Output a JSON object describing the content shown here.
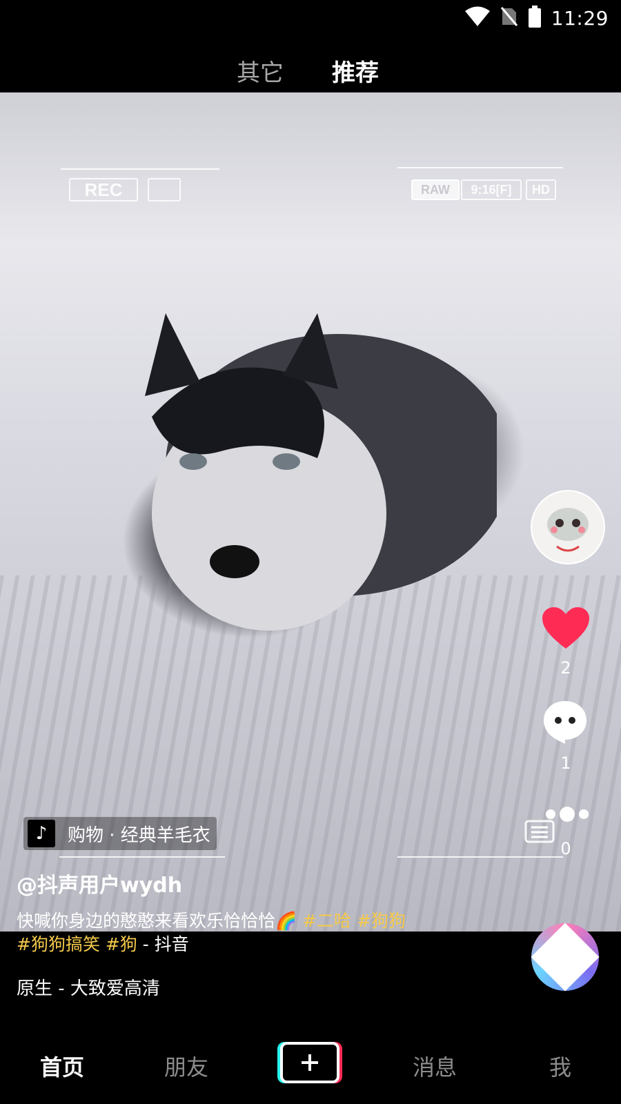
{
  "status_bar": {
    "time": "11:29",
    "icons": [
      "wifi-icon",
      "no-sim-icon",
      "battery-icon"
    ]
  },
  "top_tabs": [
    {
      "label": "其它",
      "active": false
    },
    {
      "label": "推荐",
      "active": true
    }
  ],
  "video": {
    "overlay": {
      "rec": "REC",
      "raw": "RAW",
      "ratio": "9:16[F]",
      "hd": "HD"
    }
  },
  "actions": {
    "likes": "2",
    "comments": "1",
    "shares": "0",
    "like_color": "#fe2c55"
  },
  "music_pill": {
    "text": "购物 · 经典羊毛衣"
  },
  "post": {
    "username": "@抖声用户wydh",
    "caption_text": "快喊你身边的憨憨来看欢乐恰恰恰🌈",
    "hashtags_line1": [
      " #二哈",
      " #狗狗"
    ],
    "hashtags_line2": [
      "#狗狗搞笑",
      " #狗"
    ],
    "suffix": " - 抖音",
    "music_title": "原生 - 大致爱高清",
    "hashtag_color": "#f5c94a"
  },
  "bottom_nav": [
    {
      "label": "首页",
      "active": true
    },
    {
      "label": "朋友",
      "active": false
    },
    {
      "label": "消息",
      "active": false
    },
    {
      "label": "我",
      "active": false
    }
  ]
}
